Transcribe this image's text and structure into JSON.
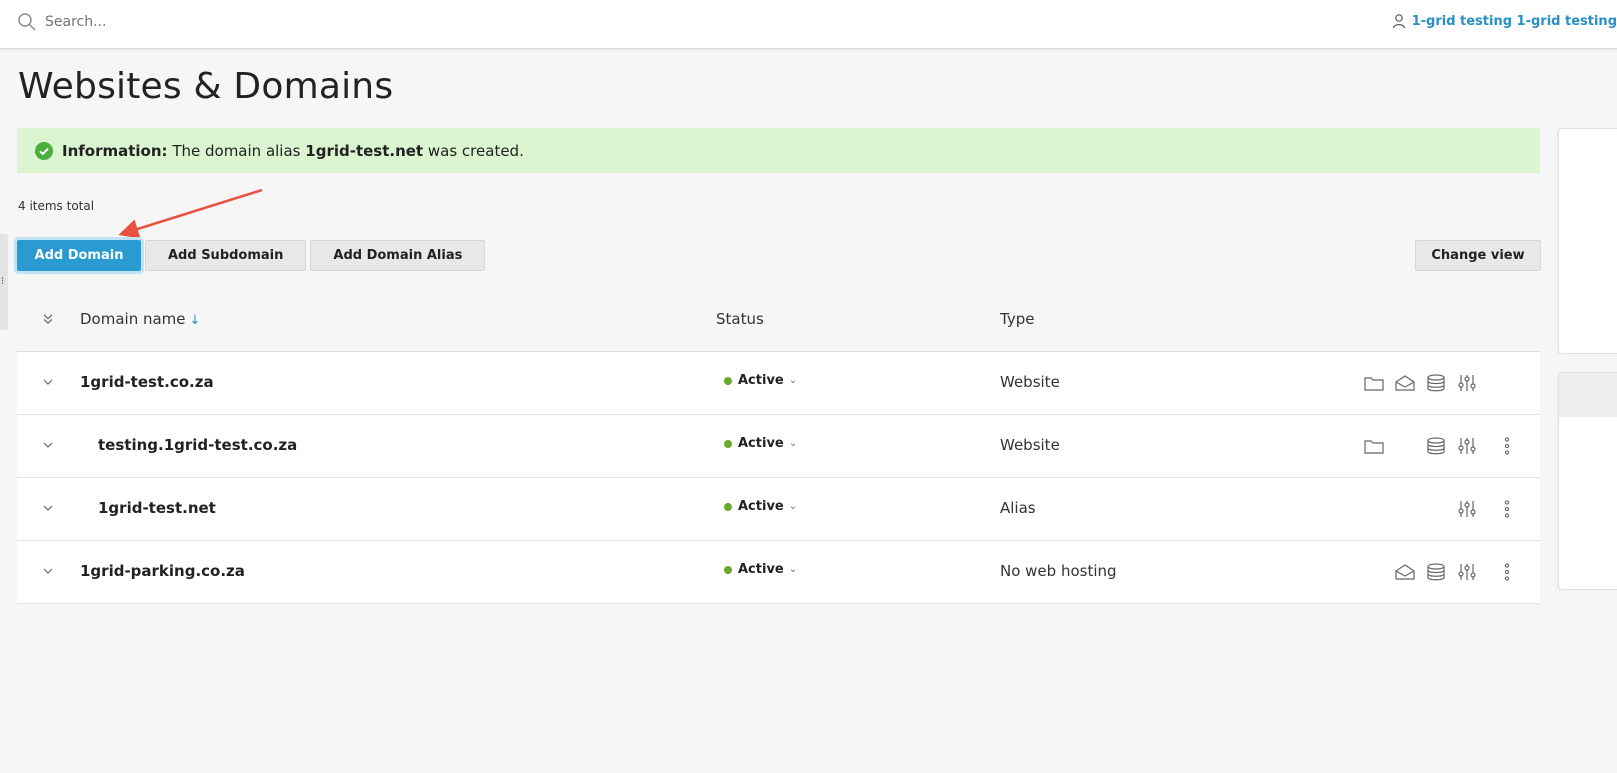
{
  "search": {
    "placeholder": "Search..."
  },
  "user": {
    "name": "1-grid testing 1-grid testing"
  },
  "page": {
    "title": "Websites & Domains"
  },
  "message": {
    "label": "Information:",
    "text_before": "The domain alias",
    "domain": "1grid-test.net",
    "text_after": "was created."
  },
  "items_total": "4 items total",
  "toolbar": {
    "add_domain": "Add Domain",
    "add_subdomain": "Add Subdomain",
    "add_domain_alias": "Add Domain Alias",
    "change_view": "Change view"
  },
  "table": {
    "headers": {
      "name": "Domain name",
      "sort": "↓",
      "status": "Status",
      "type": "Type"
    },
    "rows": [
      {
        "name": "1grid-test.co.za",
        "status": "Active",
        "type": "Website",
        "icons": [
          "folder-icon",
          "mail-icon",
          "database-icon",
          "settings-sliders-icon"
        ]
      },
      {
        "name": "testing.1grid-test.co.za",
        "status": "Active",
        "type": "Website",
        "icons": [
          "folder-icon",
          "database-icon",
          "settings-sliders-icon",
          "more-icon"
        ]
      },
      {
        "name": "1grid-test.net",
        "status": "Active",
        "type": "Alias",
        "icons": [
          "settings-sliders-icon",
          "more-icon"
        ]
      },
      {
        "name": "1grid-parking.co.za",
        "status": "Active",
        "type": "No web hosting",
        "icons": [
          "mail-icon",
          "database-icon",
          "settings-sliders-icon",
          "more-icon"
        ]
      }
    ]
  },
  "colors": {
    "accent": "#2a9bd1",
    "success_bg": "#daf5d0",
    "status_active": "#6aa82a",
    "annotation_arrow": "#e8513f"
  }
}
